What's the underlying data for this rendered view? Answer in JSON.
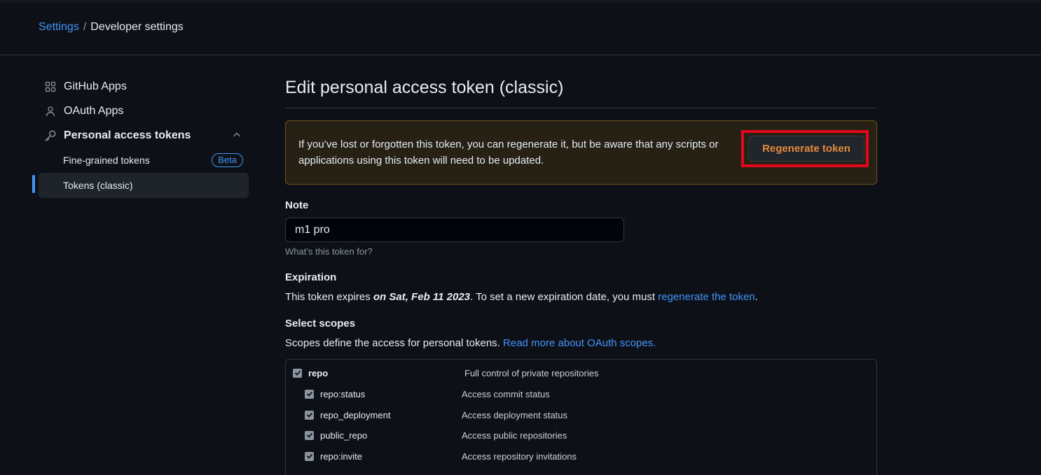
{
  "breadcrumb": {
    "root": "Settings",
    "separator": "/",
    "current": "Developer settings"
  },
  "sidebar": {
    "items": [
      {
        "label": "GitHub Apps",
        "icon": "apps-grid-icon"
      },
      {
        "label": "OAuth Apps",
        "icon": "person-icon"
      },
      {
        "label": "Personal access tokens",
        "icon": "key-icon"
      }
    ],
    "sub_items": [
      {
        "label": "Fine-grained tokens",
        "badge": "Beta"
      },
      {
        "label": "Tokens (classic)"
      }
    ]
  },
  "main": {
    "title": "Edit personal access token (classic)",
    "flash": {
      "text": "If you’ve lost or forgotten this token, you can regenerate it, but be aware that any scripts or applications using this token will need to be updated.",
      "button": "Regenerate token"
    },
    "note": {
      "label": "Note",
      "value": "m1 pro",
      "hint": "What’s this token for?"
    },
    "expiration": {
      "label": "Expiration",
      "prefix": "This token expires ",
      "date": "on Sat, Feb 11 2023",
      "middle": ". To set a new expiration date, you must ",
      "link": "regenerate the token",
      "suffix": "."
    },
    "scopes": {
      "label": "Select scopes",
      "text": "Scopes define the access for personal tokens. ",
      "link": "Read more about OAuth scopes.",
      "rows": [
        {
          "name": "repo",
          "desc": "Full control of private repositories"
        },
        {
          "name": "repo:status",
          "desc": "Access commit status"
        },
        {
          "name": "repo_deployment",
          "desc": "Access deployment status"
        },
        {
          "name": "public_repo",
          "desc": "Access public repositories"
        },
        {
          "name": "repo:invite",
          "desc": "Access repository invitations"
        }
      ]
    }
  },
  "colors": {
    "accent": "#4493f8",
    "warning_button_text": "#e3893c",
    "highlight_outline": "#e5051d"
  }
}
